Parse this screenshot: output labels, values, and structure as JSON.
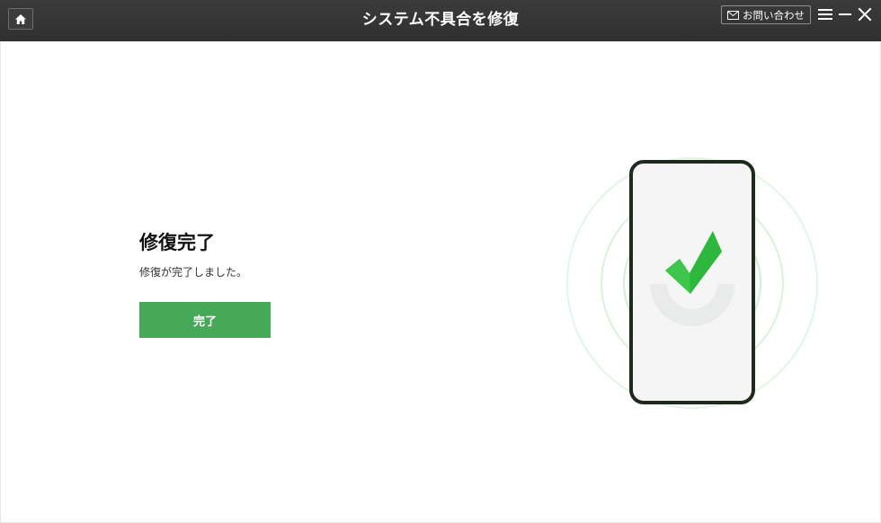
{
  "header": {
    "title": "システム不具合を修復",
    "contact_label": "お問い合わせ",
    "icons": {
      "home": "home-icon",
      "mail": "mail-icon",
      "menu": "menu-icon",
      "minimize": "minimize-icon",
      "close": "close-icon"
    }
  },
  "main": {
    "heading": "修復完了",
    "message": "修復が完了しました。",
    "done_button": "完了"
  },
  "colors": {
    "titlebar": "#333433",
    "accent_green": "#46a957",
    "check_green": "#2db83d",
    "phone_frame": "#1f2a1f"
  }
}
